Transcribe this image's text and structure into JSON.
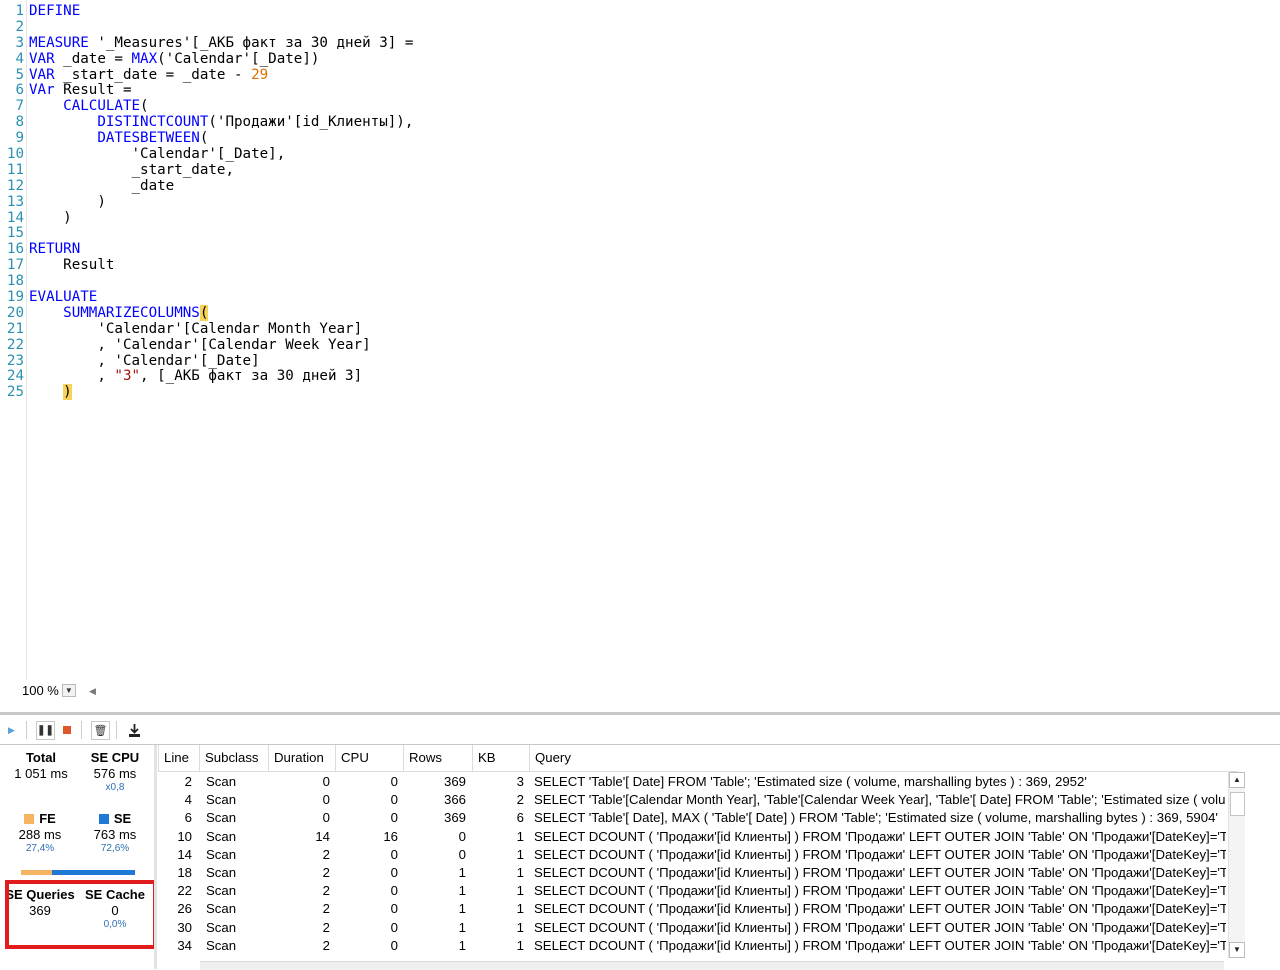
{
  "editor": {
    "lines": [
      [
        {
          "c": "kw",
          "t": "DEFINE"
        }
      ],
      [],
      [
        {
          "c": "kw",
          "t": "MEASURE"
        },
        {
          "c": "tx",
          "t": " '_Measures'[_АКБ факт за 30 дней 3] ="
        }
      ],
      [
        {
          "c": "kw",
          "t": "VAR"
        },
        {
          "c": "tx",
          "t": " _date = "
        },
        {
          "c": "fn",
          "t": "MAX"
        },
        {
          "c": "tx",
          "t": "('Calendar'[_Date])"
        }
      ],
      [
        {
          "c": "kw",
          "t": "VAR"
        },
        {
          "c": "tx",
          "t": " _start_date = _date - "
        },
        {
          "c": "nm",
          "t": "29"
        }
      ],
      [
        {
          "c": "kw",
          "t": "VAr"
        },
        {
          "c": "tx",
          "t": " Result ="
        }
      ],
      [
        {
          "c": "tx",
          "t": "    "
        },
        {
          "c": "fn",
          "t": "CALCULATE"
        },
        {
          "c": "tx",
          "t": "("
        }
      ],
      [
        {
          "c": "tx",
          "t": "        "
        },
        {
          "c": "fn",
          "t": "DISTINCTCOUNT"
        },
        {
          "c": "tx",
          "t": "('Продажи'[id_Клиенты]),"
        }
      ],
      [
        {
          "c": "tx",
          "t": "        "
        },
        {
          "c": "fn",
          "t": "DATESBETWEEN"
        },
        {
          "c": "tx",
          "t": "("
        }
      ],
      [
        {
          "c": "tx",
          "t": "            'Calendar'[_Date],"
        }
      ],
      [
        {
          "c": "tx",
          "t": "            _start_date,"
        }
      ],
      [
        {
          "c": "tx",
          "t": "            _date"
        }
      ],
      [
        {
          "c": "tx",
          "t": "        )"
        }
      ],
      [
        {
          "c": "tx",
          "t": "    )"
        }
      ],
      [],
      [
        {
          "c": "kw",
          "t": "RETURN"
        }
      ],
      [
        {
          "c": "tx",
          "t": "    Result"
        }
      ],
      [],
      [
        {
          "c": "kw",
          "t": "EVALUATE"
        }
      ],
      [
        {
          "c": "tx",
          "t": "    "
        },
        {
          "c": "fn",
          "t": "SUMMARIZECOLUMNS"
        },
        {
          "c": "hl",
          "t": "("
        }
      ],
      [
        {
          "c": "tx",
          "t": "        'Calendar'[Calendar Month Year]"
        }
      ],
      [
        {
          "c": "tx",
          "t": "        , 'Calendar'[Calendar Week Year]"
        }
      ],
      [
        {
          "c": "tx",
          "t": "        , 'Calendar'[_Date]"
        }
      ],
      [
        {
          "c": "tx",
          "t": "        , "
        },
        {
          "c": "st",
          "t": "\"3\""
        },
        {
          "c": "tx",
          "t": ", [_АКБ факт за 30 дней 3]"
        }
      ],
      [
        {
          "c": "tx",
          "t": "    "
        },
        {
          "c": "hl",
          "t": ")"
        }
      ]
    ],
    "zoom": "100 %"
  },
  "toolbar": {
    "play_icon": "play-icon",
    "pause_icon": "pause-icon",
    "stop_icon": "stop-icon",
    "clear_icon": "trash-icon",
    "export_icon": "download-icon"
  },
  "stats": {
    "total_label": "Total",
    "total_value": "1 051 ms",
    "se_cpu_label": "SE CPU",
    "se_cpu_value": "576 ms",
    "se_cpu_ratio": "x0,8",
    "fe_label": "FE",
    "fe_value": "288 ms",
    "fe_pct": "27,4%",
    "fe_fraction": 0.274,
    "se_label": "SE",
    "se_value": "763 ms",
    "se_pct": "72,6%",
    "se_fraction": 0.726,
    "se_queries_label": "SE Queries",
    "se_queries_value": "369",
    "se_cache_label": "SE Cache",
    "se_cache_value": "0",
    "se_cache_pct": "0,0%",
    "fe_color": "#f5b461",
    "se_color": "#1e78d6",
    "highlight_color": "#e01c1c"
  },
  "grid": {
    "columns": [
      "Line",
      "Subclass",
      "Duration",
      "CPU",
      "Rows",
      "KB",
      "Query"
    ],
    "rows": [
      [
        "2",
        "Scan",
        "0",
        "0",
        "369",
        "3",
        "SELECT 'Table'[ Date] FROM 'Table';   'Estimated size ( volume, marshalling bytes ) : 369, 2952'"
      ],
      [
        "4",
        "Scan",
        "0",
        "0",
        "366",
        "2",
        "SELECT 'Table'[Calendar Month Year], 'Table'[Calendar Week Year], 'Table'[ Date] FROM 'Table';   'Estimated size ( volu"
      ],
      [
        "6",
        "Scan",
        "0",
        "0",
        "369",
        "6",
        "SELECT 'Table'[ Date], MAX ( 'Table'[ Date] ) FROM 'Table';   'Estimated size ( volume, marshalling bytes ) : 369, 5904'"
      ],
      [
        "10",
        "Scan",
        "14",
        "16",
        "0",
        "1",
        "SELECT DCOUNT ( 'Продажи'[id Клиенты] ) FROM 'Продажи' LEFT OUTER JOIN 'Table' ON 'Продажи'[DateKey]='T"
      ],
      [
        "14",
        "Scan",
        "2",
        "0",
        "0",
        "1",
        "SELECT DCOUNT ( 'Продажи'[id Клиенты] ) FROM 'Продажи' LEFT OUTER JOIN 'Table' ON 'Продажи'[DateKey]='T"
      ],
      [
        "18",
        "Scan",
        "2",
        "0",
        "1",
        "1",
        "SELECT DCOUNT ( 'Продажи'[id Клиенты] ) FROM 'Продажи' LEFT OUTER JOIN 'Table' ON 'Продажи'[DateKey]='T"
      ],
      [
        "22",
        "Scan",
        "2",
        "0",
        "1",
        "1",
        "SELECT DCOUNT ( 'Продажи'[id Клиенты] ) FROM 'Продажи' LEFT OUTER JOIN 'Table' ON 'Продажи'[DateKey]='T"
      ],
      [
        "26",
        "Scan",
        "2",
        "0",
        "1",
        "1",
        "SELECT DCOUNT ( 'Продажи'[id Клиенты] ) FROM 'Продажи' LEFT OUTER JOIN 'Table' ON 'Продажи'[DateKey]='T"
      ],
      [
        "30",
        "Scan",
        "2",
        "0",
        "1",
        "1",
        "SELECT DCOUNT ( 'Продажи'[id Клиенты] ) FROM 'Продажи' LEFT OUTER JOIN 'Table' ON 'Продажи'[DateKey]='T"
      ],
      [
        "34",
        "Scan",
        "2",
        "0",
        "1",
        "1",
        "SELECT DCOUNT ( 'Продажи'[id Клиенты] ) FROM 'Продажи' LEFT OUTER JOIN 'Table' ON 'Продажи'[DateKey]='T"
      ]
    ]
  }
}
